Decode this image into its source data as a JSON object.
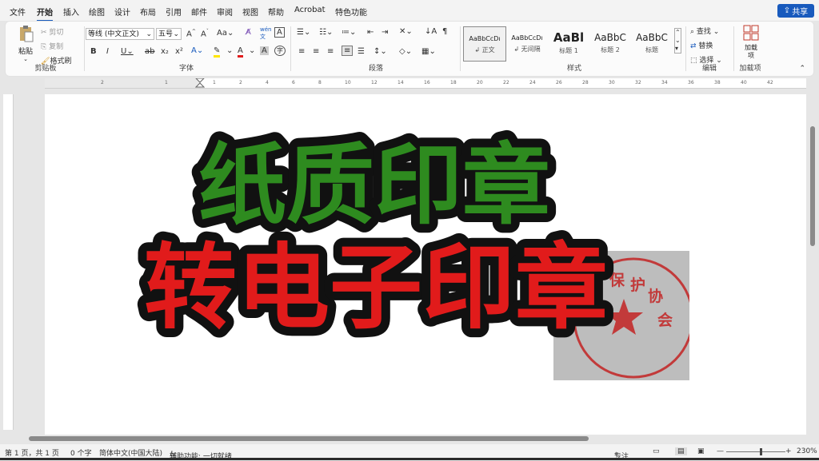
{
  "menu": {
    "items": [
      "文件",
      "开始",
      "插入",
      "绘图",
      "设计",
      "布局",
      "引用",
      "邮件",
      "审阅",
      "视图",
      "帮助",
      "Acrobat",
      "特色功能"
    ],
    "active": "开始",
    "share_label": "共享"
  },
  "ribbon": {
    "clipboard": {
      "paste": "粘贴",
      "cut": "剪切",
      "copy": "复制",
      "format_painter": "格式刷",
      "group_label": "剪贴板"
    },
    "font": {
      "font_name": "等线 (中文正文)",
      "font_size": "五号",
      "group_label": "字体",
      "change_case": "Aa",
      "wen": "wén"
    },
    "paragraph": {
      "group_label": "段落"
    },
    "styles": {
      "group_label": "样式",
      "items": [
        {
          "sample": "AaBbCcDı",
          "name": "正文"
        },
        {
          "sample": "AaBbCcDı",
          "name": "无间隔"
        },
        {
          "sample": "AaBl",
          "name": "标题 1"
        },
        {
          "sample": "AaBbC",
          "name": "标题 2"
        },
        {
          "sample": "AaBbC",
          "name": "标题"
        }
      ]
    },
    "editing": {
      "find": "查找",
      "replace": "替换",
      "select": "选择",
      "group_label": "编辑"
    },
    "addins": {
      "button": "加载项",
      "group_label": "加载项"
    }
  },
  "ruler_ticks": [
    "1",
    "2",
    "1",
    "2",
    "4",
    "6",
    "8",
    "10",
    "12",
    "14",
    "16",
    "18",
    "20",
    "22",
    "24",
    "26",
    "28",
    "30",
    "32",
    "34",
    "36",
    "38",
    "40",
    "42"
  ],
  "document": {
    "title_line1": "纸质印章",
    "title_line2": "转电子印章",
    "stamp_text": [
      "护",
      "协",
      "保",
      "会"
    ]
  },
  "colors": {
    "green": "#2e8b1f",
    "red": "#e11b1b",
    "stamp_red": "#c23a3a",
    "accent": "#185abd"
  },
  "status": {
    "page": "第 1 页，共 1 页",
    "words": "0 个字",
    "language": "简体中文(中国大陆)",
    "accessibility": "辅助功能: 一切就绪",
    "focus": "专注",
    "zoom": "230%"
  }
}
